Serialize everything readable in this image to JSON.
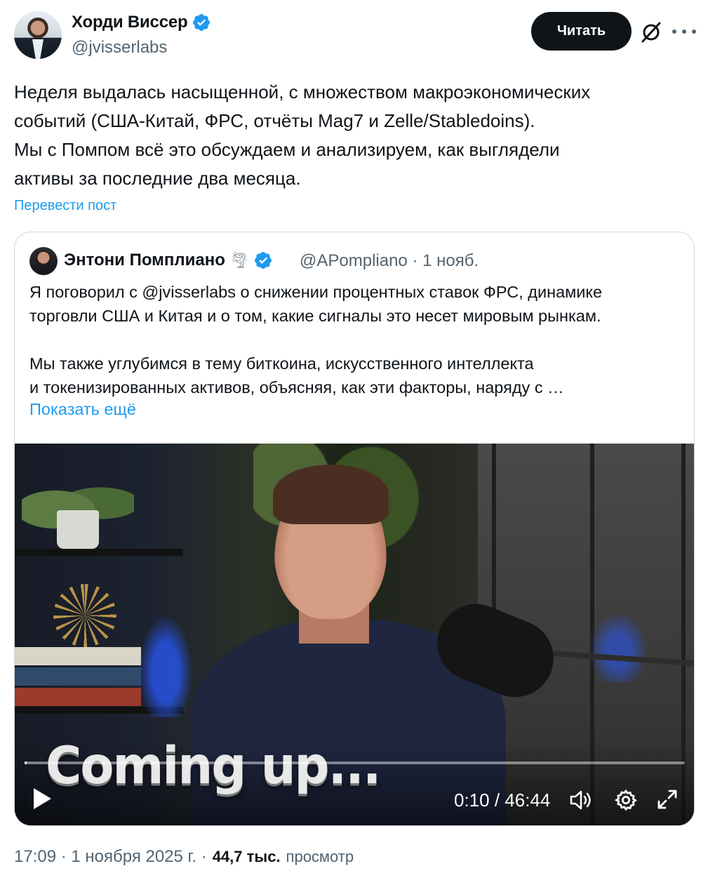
{
  "post": {
    "author_name": "Хорди Виссер",
    "author_handle": "@jvisserlabs",
    "follow_label": "Читать",
    "text_lines": [
      "Неделя выдалась насыщенной, с множеством макроэкономических",
      "событий (США-Китай, ФРС, отчёты Mag7 и Zelle/Stabledoins).",
      "Мы с Помпом всё это обсуждаем и анализируем, как выглядели",
      "активы за последние два месяца."
    ],
    "translate_label": "Перевести пост"
  },
  "quote": {
    "author_name": "Энтони Помплиано",
    "emoji": "🌪",
    "handle_date": "@APompliano · 1 нояб.",
    "para1_lines": [
      "Я поговорил с  @jvisserlabs  о снижении процентных ставок ФРС, динамике",
      "торговли США и Китая и о том, какие сигналы это несет мировым рынкам."
    ],
    "para2_lines": [
      "Мы также углубимся в тему биткоина, искусственного интеллекта",
      "и токенизированных активов, объясняя, как эти факторы, наряду с …"
    ],
    "show_more_label": "Показать ещё"
  },
  "video": {
    "overlay_title": "Coming up...",
    "time_display": "0:10 / 46:44",
    "progress_fraction": 0.0036
  },
  "meta": {
    "timestamp": "17:09 · 1 ноября 2025 г. ·",
    "views_count": "44,7 тыс.",
    "views_label": "просмотр"
  },
  "colors": {
    "accent": "#1d9bf0",
    "text_primary": "#0f1419",
    "text_secondary": "#536471",
    "border": "#cfd9de"
  }
}
